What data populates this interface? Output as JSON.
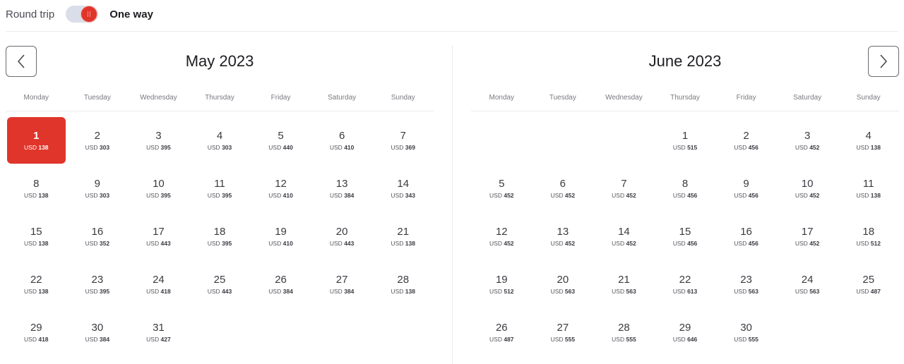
{
  "trip_type": {
    "round_trip_label": "Round trip",
    "one_way_label": "One way",
    "selected": "One way",
    "accent_color": "#e0352b"
  },
  "navigation": {
    "prev_icon": "chevron-left-icon",
    "next_icon": "chevron-right-icon"
  },
  "weekdays": [
    "Monday",
    "Tuesday",
    "Wednesday",
    "Thursday",
    "Friday",
    "Saturday",
    "Sunday"
  ],
  "currency": "USD",
  "months": [
    {
      "title": "May 2023",
      "leading_blanks": 0,
      "selected_day": 1,
      "days": [
        {
          "day": "1",
          "price": "138"
        },
        {
          "day": "2",
          "price": "303"
        },
        {
          "day": "3",
          "price": "395"
        },
        {
          "day": "4",
          "price": "303"
        },
        {
          "day": "5",
          "price": "440"
        },
        {
          "day": "6",
          "price": "410"
        },
        {
          "day": "7",
          "price": "369"
        },
        {
          "day": "8",
          "price": "138"
        },
        {
          "day": "9",
          "price": "303"
        },
        {
          "day": "10",
          "price": "395"
        },
        {
          "day": "11",
          "price": "395"
        },
        {
          "day": "12",
          "price": "410"
        },
        {
          "day": "13",
          "price": "384"
        },
        {
          "day": "14",
          "price": "343"
        },
        {
          "day": "15",
          "price": "138"
        },
        {
          "day": "16",
          "price": "352"
        },
        {
          "day": "17",
          "price": "443"
        },
        {
          "day": "18",
          "price": "395"
        },
        {
          "day": "19",
          "price": "410"
        },
        {
          "day": "20",
          "price": "443"
        },
        {
          "day": "21",
          "price": "138"
        },
        {
          "day": "22",
          "price": "138"
        },
        {
          "day": "23",
          "price": "395"
        },
        {
          "day": "24",
          "price": "418"
        },
        {
          "day": "25",
          "price": "443"
        },
        {
          "day": "26",
          "price": "384"
        },
        {
          "day": "27",
          "price": "384"
        },
        {
          "day": "28",
          "price": "138"
        },
        {
          "day": "29",
          "price": "418"
        },
        {
          "day": "30",
          "price": "384"
        },
        {
          "day": "31",
          "price": "427"
        }
      ]
    },
    {
      "title": "June 2023",
      "leading_blanks": 3,
      "selected_day": null,
      "days": [
        {
          "day": "1",
          "price": "515"
        },
        {
          "day": "2",
          "price": "456"
        },
        {
          "day": "3",
          "price": "452"
        },
        {
          "day": "4",
          "price": "138"
        },
        {
          "day": "5",
          "price": "452"
        },
        {
          "day": "6",
          "price": "452"
        },
        {
          "day": "7",
          "price": "452"
        },
        {
          "day": "8",
          "price": "456"
        },
        {
          "day": "9",
          "price": "456"
        },
        {
          "day": "10",
          "price": "452"
        },
        {
          "day": "11",
          "price": "138"
        },
        {
          "day": "12",
          "price": "452"
        },
        {
          "day": "13",
          "price": "452"
        },
        {
          "day": "14",
          "price": "452"
        },
        {
          "day": "15",
          "price": "456"
        },
        {
          "day": "16",
          "price": "456"
        },
        {
          "day": "17",
          "price": "452"
        },
        {
          "day": "18",
          "price": "512"
        },
        {
          "day": "19",
          "price": "512"
        },
        {
          "day": "20",
          "price": "563"
        },
        {
          "day": "21",
          "price": "563"
        },
        {
          "day": "22",
          "price": "613"
        },
        {
          "day": "23",
          "price": "563"
        },
        {
          "day": "24",
          "price": "563"
        },
        {
          "day": "25",
          "price": "487"
        },
        {
          "day": "26",
          "price": "487"
        },
        {
          "day": "27",
          "price": "555"
        },
        {
          "day": "28",
          "price": "555"
        },
        {
          "day": "29",
          "price": "646"
        },
        {
          "day": "30",
          "price": "555"
        }
      ]
    }
  ]
}
